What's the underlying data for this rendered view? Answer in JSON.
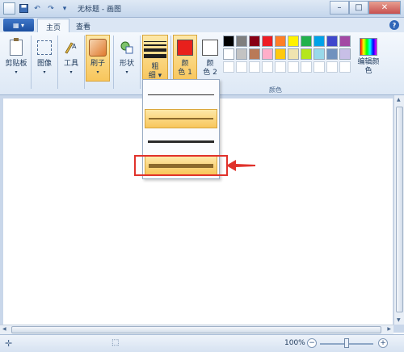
{
  "window": {
    "title": "无标题 - 画图",
    "minimize_glyph": "–",
    "maximize_glyph": "□",
    "close_glyph": "✕"
  },
  "tabs": [
    {
      "label": "主页",
      "active": true
    },
    {
      "label": "查看",
      "active": false
    }
  ],
  "ribbon": {
    "clipboard": {
      "label": "剪贴板",
      "icon": "clipboard-icon"
    },
    "image": {
      "label": "图像",
      "icon": "image-select-icon"
    },
    "tools": {
      "label": "工具",
      "icon": "tools-icon"
    },
    "brushes": {
      "label": "刷子",
      "icon": "brush-icon"
    },
    "shapes": {
      "label": "形状",
      "icon": "shapes-icon"
    },
    "size": {
      "label_top": "粗",
      "label_bottom": "细",
      "icon": "line-thickness-icon"
    },
    "color1": {
      "label_top": "颜",
      "label_bottom": "色 1",
      "color": "#e8201c"
    },
    "color2": {
      "label_top": "颜",
      "label_bottom": "色 2",
      "color": "#ffffff"
    },
    "edit_colors": {
      "label": "编辑颜色",
      "icon": "color-spectrum-icon"
    },
    "colors_group_label": "颜色",
    "palette_row1": [
      "#000000",
      "#7f7f7f",
      "#880015",
      "#ed1c24",
      "#ff7f27",
      "#fff200",
      "#22b14c",
      "#00a2e8",
      "#3f48cc",
      "#a349a4"
    ],
    "palette_row2": [
      "#ffffff",
      "#c3c3c3",
      "#b97a57",
      "#ffaec9",
      "#ffc90e",
      "#efe4b0",
      "#b5e61d",
      "#99d9ea",
      "#7092be",
      "#c8bfe7"
    ]
  },
  "dropdown": {
    "options": [
      {
        "name": "size-1px",
        "selected": false
      },
      {
        "name": "size-3px",
        "selected": true
      },
      {
        "name": "size-5px",
        "selected": false
      },
      {
        "name": "size-8px",
        "selected": true
      }
    ]
  },
  "statusbar": {
    "zoom": "100%",
    "zoom_out": "−",
    "zoom_in": "+"
  }
}
